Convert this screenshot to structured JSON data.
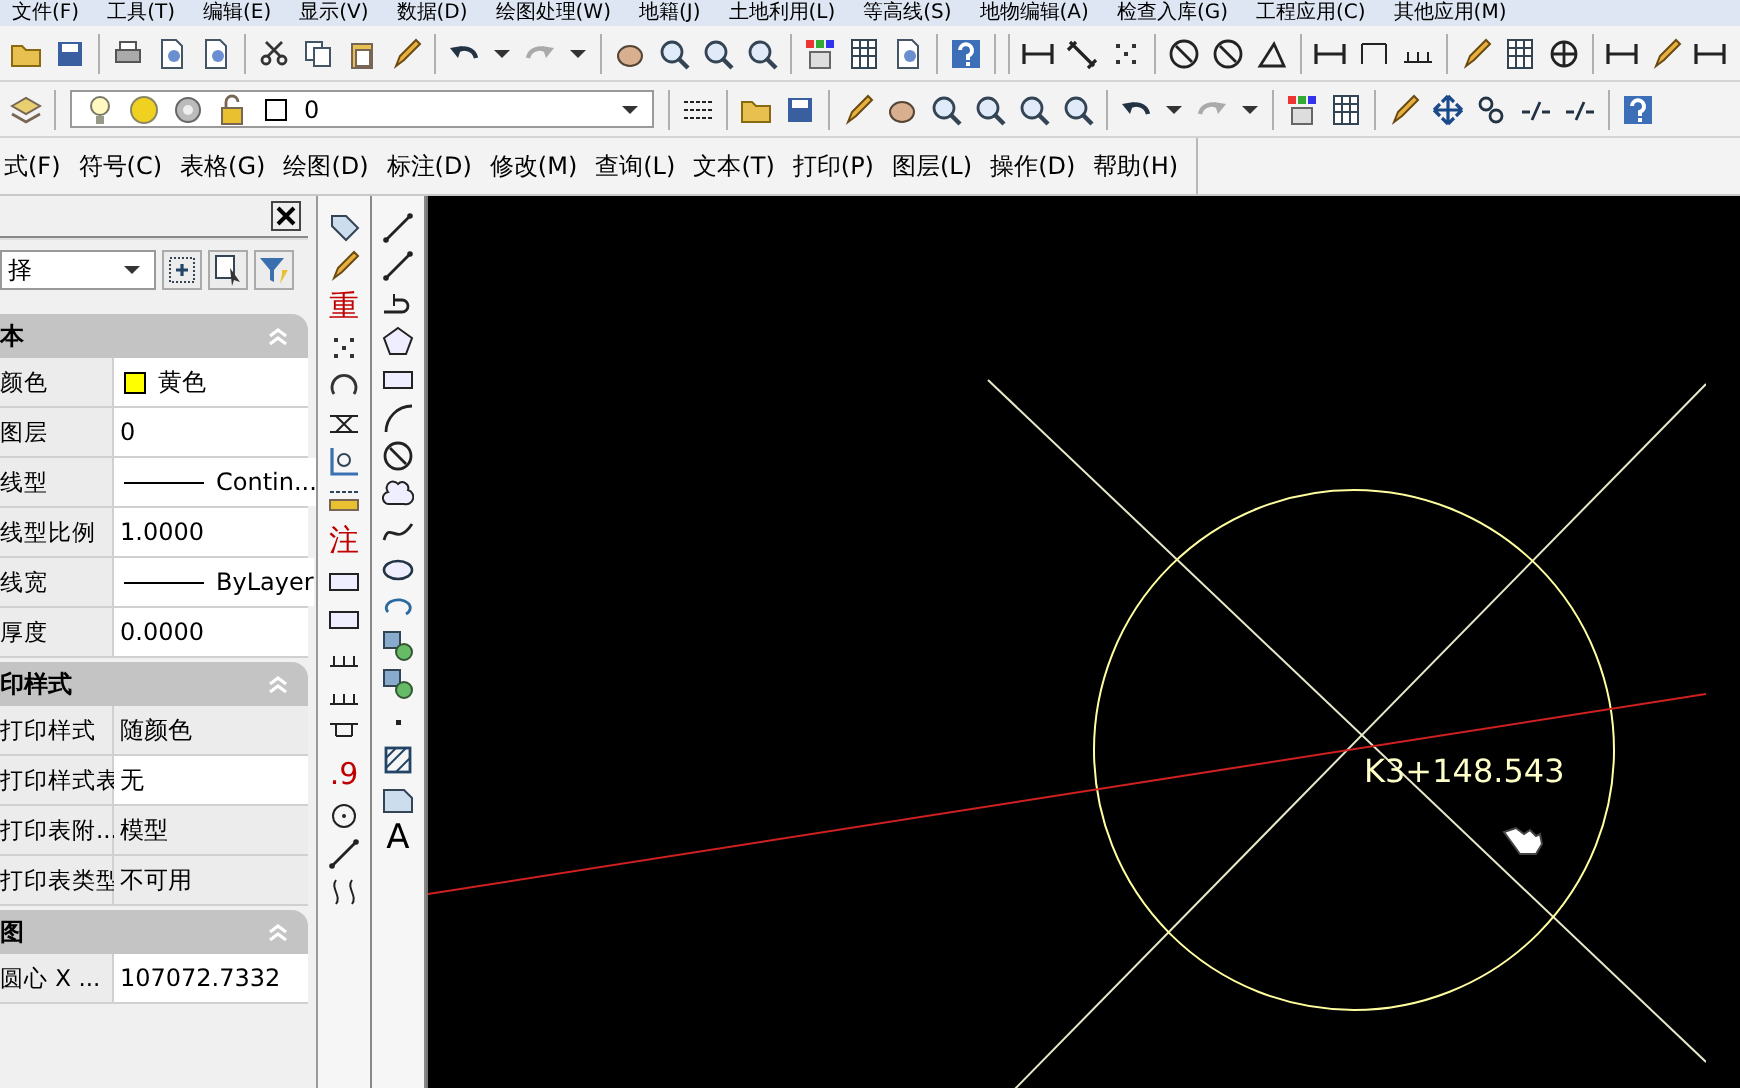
{
  "top_menu": [
    "文件(F)",
    "工具(T)",
    "编辑(E)",
    "显示(V)",
    "数据(D)",
    "绘图处理(W)",
    "地籍(J)",
    "土地利用(L)",
    "等高线(S)",
    "地物编辑(A)",
    "检查入库(G)",
    "工程应用(C)",
    "其他应用(M)"
  ],
  "layer_dropdown": {
    "value": "0"
  },
  "menu_bar": [
    "式(F)",
    "符号(C)",
    "表格(G)",
    "绘图(D)",
    "标注(D)",
    "修改(M)",
    "查询(L)",
    "文本(T)",
    "打印(P)",
    "图层(L)",
    "操作(D)",
    "帮助(H)"
  ],
  "properties": {
    "selector": "择",
    "sections": [
      {
        "title": "本",
        "rows": [
          {
            "label": "颜色",
            "value": "黄色",
            "kind": "color",
            "color": "#ffff00",
            "editable": true
          },
          {
            "label": "图层",
            "value": "0",
            "kind": "text",
            "editable": true
          },
          {
            "label": "线型",
            "value": "Contin...",
            "kind": "line",
            "editable": true
          },
          {
            "label": "线型比例",
            "value": "1.0000",
            "kind": "text",
            "editable": true
          },
          {
            "label": "线宽",
            "value": "ByLayer",
            "kind": "line",
            "editable": true
          },
          {
            "label": "厚度",
            "value": "0.0000",
            "kind": "text",
            "editable": true
          }
        ]
      },
      {
        "title": "印样式",
        "rows": [
          {
            "label": "打印样式",
            "value": "随颜色",
            "kind": "text",
            "editable": false
          },
          {
            "label": "打印样式表",
            "value": "无",
            "kind": "text",
            "editable": true
          },
          {
            "label": "打印表附...",
            "value": "模型",
            "kind": "text",
            "editable": false
          },
          {
            "label": "打印表类型",
            "value": "不可用",
            "kind": "text",
            "editable": false
          }
        ]
      },
      {
        "title": "图",
        "rows": [
          {
            "label": "圆心 X ...",
            "value": "107072.7332",
            "kind": "text",
            "editable": true
          }
        ]
      }
    ]
  },
  "tool_column_1_labels": [
    "重",
    "注",
    ".9"
  ],
  "tool_column_2_labels": [
    "A"
  ],
  "drawing": {
    "label": "K3+148.543"
  }
}
